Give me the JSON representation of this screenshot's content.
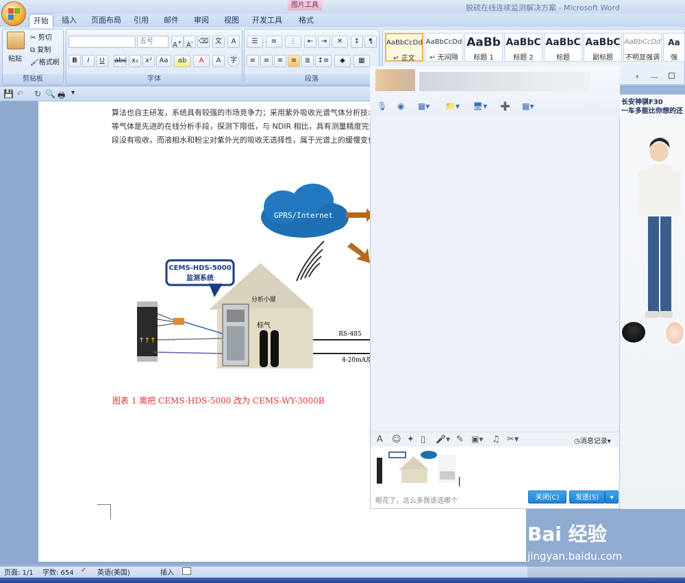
{
  "window": {
    "title": "脱硫在线连续监测解决方案 - Microsoft Word",
    "contextual_tab_group": "图片工具"
  },
  "tabs": [
    {
      "label": "开始",
      "active": true
    },
    {
      "label": "插入"
    },
    {
      "label": "页面布局"
    },
    {
      "label": "引用"
    },
    {
      "label": "邮件"
    },
    {
      "label": "审阅"
    },
    {
      "label": "视图"
    },
    {
      "label": "开发工具"
    },
    {
      "label": "格式"
    }
  ],
  "clipboard": {
    "paste": "粘贴",
    "cut": "剪切",
    "copy": "复制",
    "format_painter": "格式刷",
    "group": "剪贴板"
  },
  "font": {
    "name_value": "",
    "size_value": "五号",
    "group": "字体"
  },
  "paragraph": {
    "group": "段落"
  },
  "styles": [
    {
      "sample": "AaBbCcDd",
      "name": "↵ 正文"
    },
    {
      "sample": "AaBbCcDd",
      "name": "↵ 无间隔"
    },
    {
      "sample": "AaBb",
      "name": "标题 1"
    },
    {
      "sample": "AaBbC",
      "name": "标题 2"
    },
    {
      "sample": "AaBbC",
      "name": "标题"
    },
    {
      "sample": "AaBbC",
      "name": "副标题"
    },
    {
      "sample": "AaBbCcDd",
      "name": "不明显强调"
    },
    {
      "sample": "Aa",
      "name": "强"
    }
  ],
  "document": {
    "lines": [
      "算法也自主研发，系统具有较强的市场竞争力；采用紫外吸收光谱气体分析技术和化学计量",
      "等气体是先进的在线分析手段，探测下限低，与 NDIR 相比，具有测量精度完全不受水分和",
      "段没有吸收，而液相水和粉尘对紫外光的吸收无选择性，属于光谱上的缓慢变化）、探测"
    ],
    "figure": {
      "cloud_label": "GPRS/Internet",
      "callout_line1": "CEMS-HDS-5000",
      "callout_line2": "监测系统",
      "house_label": "分析小屋",
      "gas_label": "标气",
      "link1": "RS-485",
      "link2": "4-20mA及"
    },
    "caption": "图表 1   需把 CEMS-HDS-5000 改为 CEMS-WY-3000B"
  },
  "status": {
    "page": "页面: 1/1",
    "words": "字数: 654",
    "language": "英语(美国)",
    "insert": "插入"
  },
  "chat": {
    "history": "消息记录",
    "hint": "眼花了，这么多我该选哪个",
    "close_label": "关闭(C)",
    "send_label": "发送(S)"
  },
  "ad": {
    "line1": "长安神骐F30",
    "line2": "一车多能比你想的还"
  },
  "watermark": {
    "brand": "Bai 经验",
    "url": "jingyan.baidu.com"
  },
  "colors": {
    "accent": "#2b8ee0",
    "caption_red": "#e23232",
    "ad_red": "#d8322f"
  }
}
